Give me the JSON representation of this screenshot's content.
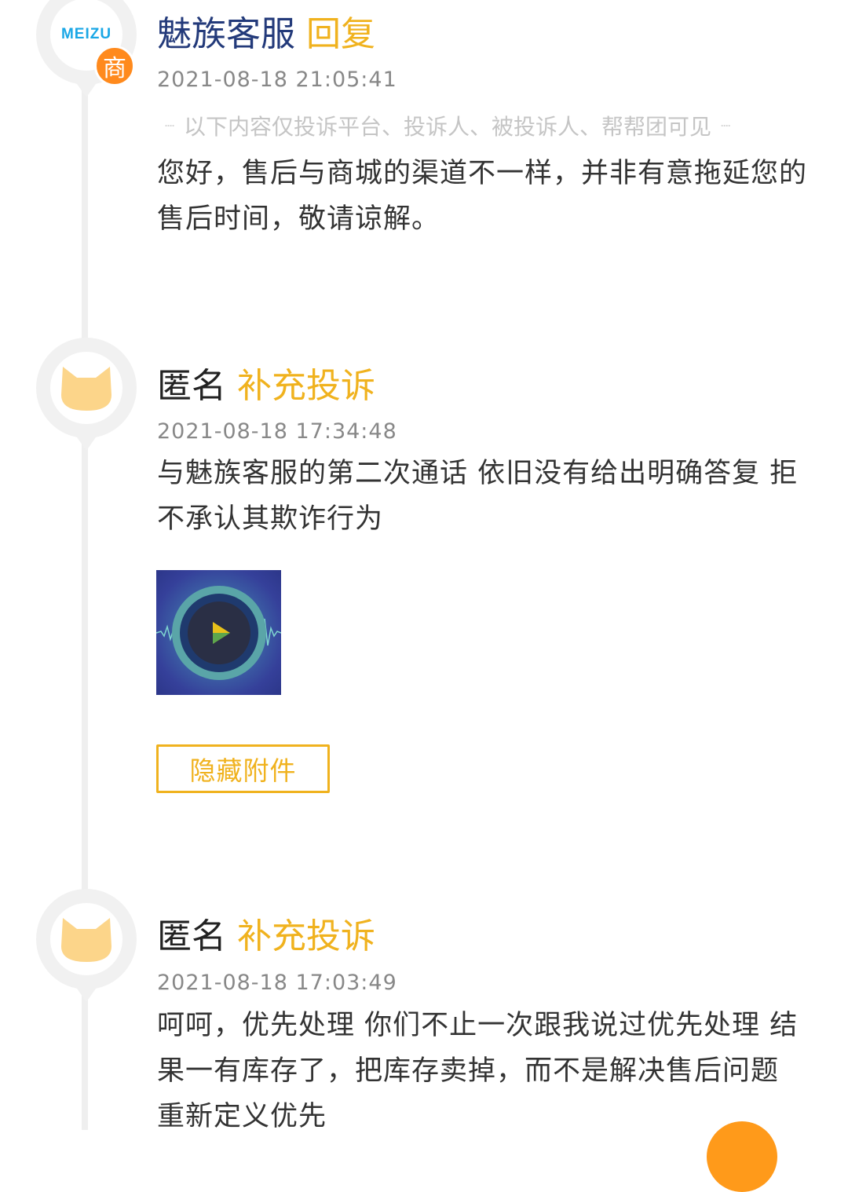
{
  "entries": [
    {
      "name": "魅族客服",
      "action": "回复",
      "time": "2021-08-18 21:05:41",
      "visibility_note": "以下内容仅投诉平台、投诉人、被投诉人、帮帮团可见",
      "text": "您好，售后与商城的渠道不一样，并非有意拖延您的售后时间，敬请谅解。",
      "avatar": {
        "logo_text": "MEIZU",
        "badge": "商"
      }
    },
    {
      "name": "匿名",
      "action": "补充投诉",
      "time": "2021-08-18 17:34:48",
      "text": "与魅族客服的第二次通话 依旧没有给出明确答复 拒不承认其欺诈行为",
      "attachment": {
        "icon": "play-icon"
      },
      "hide_button": "隐藏附件"
    },
    {
      "name": "匿名",
      "action": "补充投诉",
      "time": "2021-08-18 17:03:49",
      "text": "呵呵，优先处理 你们不止一次跟我说过优先处理 结果一有库存了，把库存卖掉，而不是解决售后问题 重新定义优先"
    }
  ],
  "colors": {
    "accent": "#f0b21e",
    "merchant_name": "#233a7a",
    "badge": "#ff8a1d",
    "timeline": "#efefef"
  }
}
